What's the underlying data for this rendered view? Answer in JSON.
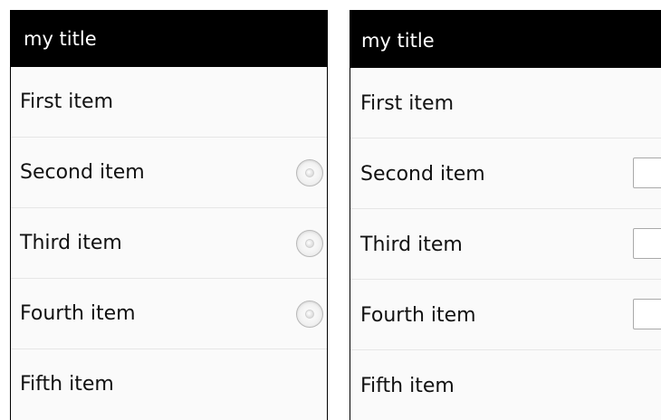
{
  "left_panel": {
    "title": "my title",
    "items": [
      {
        "label": "First item",
        "control": "none"
      },
      {
        "label": "Second item",
        "control": "radio"
      },
      {
        "label": "Third item",
        "control": "radio"
      },
      {
        "label": "Fourth item",
        "control": "radio"
      },
      {
        "label": "Fifth item",
        "control": "none"
      }
    ]
  },
  "right_panel": {
    "title": "my title",
    "items": [
      {
        "label": "First item",
        "control": "none"
      },
      {
        "label": "Second item",
        "control": "checkbox"
      },
      {
        "label": "Third item",
        "control": "checkbox"
      },
      {
        "label": "Fourth item",
        "control": "checkbox"
      },
      {
        "label": "Fifth item",
        "control": "none"
      }
    ]
  },
  "colors": {
    "titlebar_bg": "#000000",
    "titlebar_text": "#ffffff",
    "list_bg": "#fafafa",
    "divider": "#e6e6e6"
  }
}
